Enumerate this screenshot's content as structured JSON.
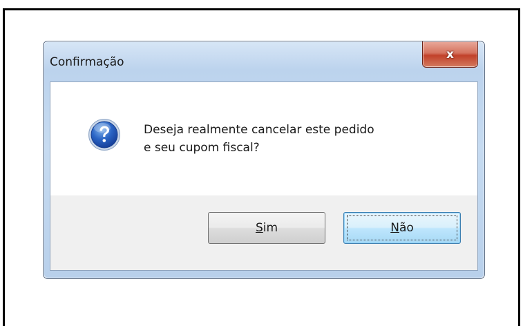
{
  "dialog": {
    "title": "Confirmação",
    "close_label": "x",
    "message_lines": [
      "Deseja realmente cancelar este pedido",
      "e seu cupom fiscal?"
    ],
    "icon": "question-icon",
    "buttons": {
      "yes": {
        "accel": "S",
        "rest": "im"
      },
      "no": {
        "accel": "N",
        "rest": "ão"
      }
    }
  },
  "colors": {
    "accent": "#3c7fb1",
    "close_button": "#c2412a",
    "frame": "#bcd3ed"
  }
}
